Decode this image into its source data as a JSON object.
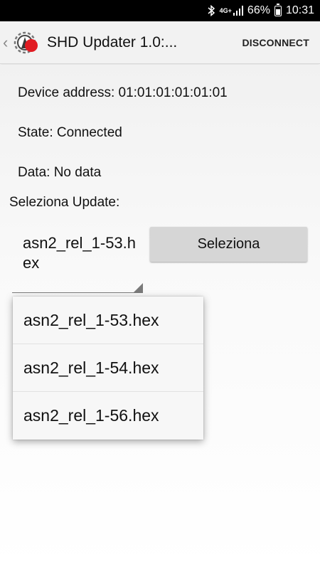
{
  "status_bar": {
    "signal_label": "4G+",
    "battery_percent": "66%",
    "time": "10:31",
    "icons": [
      "bluetooth-icon",
      "signal-icon",
      "battery-icon"
    ]
  },
  "action_bar": {
    "title": "SHD Updater 1.0:...",
    "disconnect_label": "DISCONNECT",
    "logo_icon": "app-logo-icon",
    "back_icon": "chevron-left-icon"
  },
  "device": {
    "address_line": "Device address: 01:01:01:01:01:01",
    "state_line": "State: Connected",
    "data_line": "Data: No data"
  },
  "update": {
    "section_label": "Seleziona Update:",
    "selected_value": "asn2_rel_1-53.hex",
    "button_label": "Seleziona"
  },
  "dropdown": {
    "options": [
      "asn2_rel_1-53.hex",
      "asn2_rel_1-54.hex",
      "asn2_rel_1-56.hex"
    ]
  },
  "colors": {
    "status_bar_bg": "#000000",
    "action_bar_bg": "#f2f2f2",
    "button_bg": "#d6d6d6",
    "logo_red": "#e11b22"
  }
}
